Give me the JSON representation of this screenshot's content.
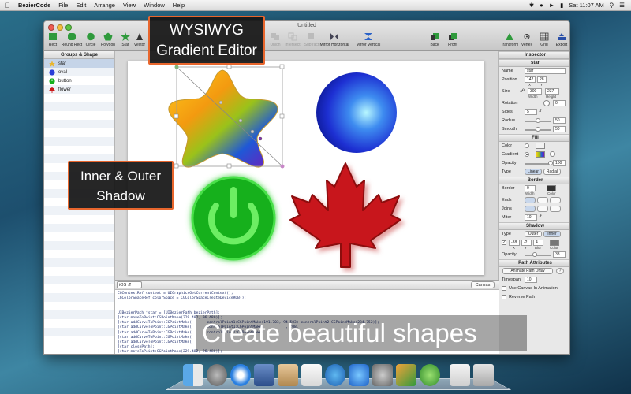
{
  "menubar": {
    "app_name": "BezierCode",
    "items": [
      "File",
      "Edit",
      "Arrange",
      "View",
      "Window",
      "Help"
    ],
    "clock": "Sat 11:07 AM"
  },
  "window": {
    "title": "Untitled",
    "toolbar_left": [
      "Rect",
      "Round Rect",
      "Circle",
      "Polygon",
      "Star",
      "Vector"
    ],
    "toolbar_mid": [
      "Union",
      "Intersect",
      "Subtract",
      "Mirror Horizontal",
      "Mirror Vertical"
    ],
    "toolbar_arrange": [
      "Back",
      "Front"
    ],
    "toolbar_right": [
      "Transform",
      "Vertex",
      "Grid",
      "Export"
    ]
  },
  "sidebar": {
    "header": "Groups & Shape",
    "items": [
      {
        "label": "star",
        "selected": true
      },
      {
        "label": "oval",
        "selected": false
      },
      {
        "label": "button",
        "selected": false
      },
      {
        "label": "flower",
        "selected": false
      }
    ]
  },
  "code_panel": {
    "platform": "iOS",
    "canvas_button": "Canvas",
    "lines": [
      "CGContextRef context = UIGraphicsGetCurrentContext();",
      "CGColorSpaceRef colorSpace = CGColorSpaceCreateDeviceRGB();",
      "",
      "",
      "UIBezierPath *star = [UIBezierPath bezierPath];",
      "[star moveToPoint:CGPointMake(229.482, 96.480)];",
      "[star addCurveToPoint:CGPointMake(       controlPoint1:CGPointMake(191.703, 94.583) controlPoint2:CGPointMake(284.752)];",
      "[star addCurveToPoint:CGPointMake(       controlPoint1:CGPointMake(          , 208.",
      "[star addCurveToPoint:CGPointMake(       controlPoint1:CGPointMake(",
      "[star addCurveToPoint:CGPointMake(",
      "[star addCurveToPoint:CGPointMake(",
      "[star closePath];",
      "[star moveToPoint:CGPointMake(229.482, 96.480)];"
    ]
  },
  "inspector": {
    "title": "Inspector",
    "shape_name": "star",
    "labels": {
      "name": "Name",
      "position": "Position",
      "size": "Size",
      "rotation": "Rotation",
      "sides": "Sides",
      "radius": "Radius",
      "smooth": "Smooth",
      "color": "Color",
      "gradient": "Gradient",
      "opacity": "Opacity",
      "type": "Type",
      "border": "Border",
      "ends": "Ends",
      "joins": "Joins",
      "miter": "Miter"
    },
    "name_value": "star",
    "position": {
      "x": "142",
      "y": "28",
      "x_label": "X",
      "y_label": "Y"
    },
    "size": {
      "width": "300",
      "height": "237",
      "width_label": "Width",
      "height_label": "Height"
    },
    "rotation": "0",
    "sides": "5",
    "radius": "50",
    "smooth": "50",
    "fill": {
      "header": "Fill",
      "opacity": "100",
      "type_linear": "Linear",
      "type_radial": "Radial"
    },
    "border": {
      "header": "Border",
      "width": "0",
      "width_label": "Width",
      "color_label": "Color",
      "miter": "10"
    },
    "shadow": {
      "header": "Shadow",
      "type_outer": "Outer",
      "type_inner": "Inner",
      "x": "-38",
      "y": "-2",
      "blur": "4",
      "x_label": "X",
      "y_label": "Y",
      "blur_label": "Blur",
      "color_label": "Color",
      "opacity": "33"
    },
    "path_attributes": {
      "header": "Path Attributes",
      "animate_button": "Animate Path Draw",
      "help": "?",
      "duration": "10",
      "timespan_label": "Timespan",
      "canvas_animation_label": "Use Canvas In Animation",
      "reverse_label": "Reverse Path"
    }
  },
  "callouts": {
    "gradient_line1": "WYSIWYG",
    "gradient_line2": "Gradient Editor",
    "shadow_line1": "Inner & Outer",
    "shadow_line2": "Shadow",
    "banner": "Create beautiful shapes"
  },
  "colors": {
    "callout_border": "#e8662d",
    "button_green": "#16b21a",
    "flower_red": "#c8141c",
    "oval_blue": "#1c2fd6"
  }
}
